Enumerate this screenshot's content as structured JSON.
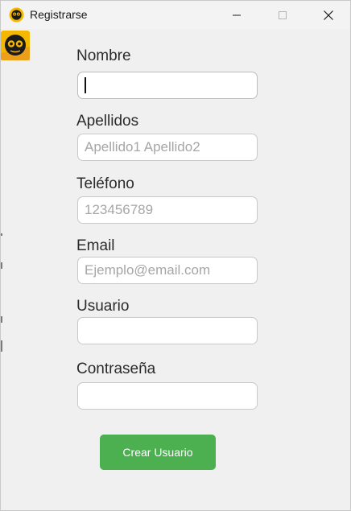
{
  "window": {
    "title": "Registrarse",
    "controls": {
      "minimize": "minimize-icon",
      "maximize": "maximize-icon",
      "close": "close-icon"
    }
  },
  "form": {
    "fields": [
      {
        "label": "Nombre",
        "value": "",
        "placeholder": ""
      },
      {
        "label": "Apellidos",
        "value": "",
        "placeholder": "Apellido1 Apellido2"
      },
      {
        "label": "Teléfono",
        "value": "",
        "placeholder": "123456789"
      },
      {
        "label": "Email",
        "value": "",
        "placeholder": "Ejemplo@email.com"
      },
      {
        "label": "Usuario",
        "value": "",
        "placeholder": ""
      },
      {
        "label": "Contraseña",
        "value": "",
        "placeholder": ""
      }
    ],
    "submit_label": "Crear Usuario"
  },
  "colors": {
    "accent": "#4caf50",
    "background": "#f0f0f0",
    "icon_yellow": "#f5b800"
  }
}
